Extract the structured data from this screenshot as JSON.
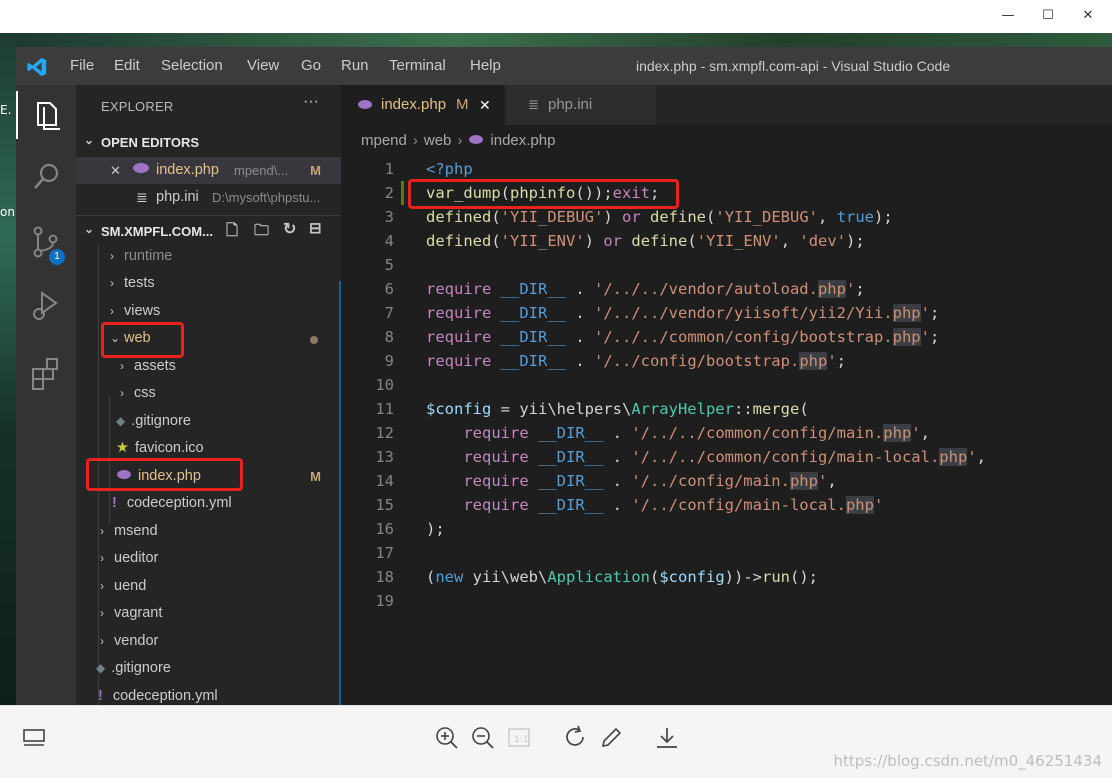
{
  "viewer": {
    "window_controls": {
      "minimize": "—",
      "maximize": "☐",
      "close": "✕"
    },
    "desktop_labels": [
      "E.",
      "on"
    ],
    "watermark": "https://blog.csdn.net/m0_46251434",
    "toolbar_icons": [
      "panel-toggle-icon",
      "zoom-in-icon",
      "zoom-out-icon",
      "actual-size-icon",
      "rotate-icon",
      "edit-icon",
      "download-icon"
    ]
  },
  "app": {
    "window_title": "index.php - sm.xmpfl.com-api - Visual Studio Code",
    "menu": [
      "File",
      "Edit",
      "Selection",
      "View",
      "Go",
      "Run",
      "Terminal",
      "Help"
    ],
    "source_control_badge": "1",
    "activity_icons": [
      "explorer-icon",
      "search-icon",
      "source-control-icon",
      "run-debug-icon",
      "extensions-icon"
    ]
  },
  "explorer": {
    "header": "EXPLORER",
    "more": "···",
    "open_editors": {
      "title": "OPEN EDITORS",
      "items": [
        {
          "close": "✕",
          "name": "index.php",
          "path": "mpend\\...",
          "status": "M"
        },
        {
          "name": "php.ini",
          "path": "D:\\mysoft\\phpstu..."
        }
      ]
    },
    "workspace": {
      "title": "SM.XMPFL.COM...",
      "tree": [
        {
          "chevron": "›",
          "name": "runtime"
        },
        {
          "chevron": "›",
          "name": "tests"
        },
        {
          "chevron": "›",
          "name": "views"
        },
        {
          "chevron": "⌄",
          "name": "web"
        },
        {
          "chevron": "›",
          "name": "assets"
        },
        {
          "chevron": "›",
          "name": "css"
        },
        {
          "name": ".gitignore"
        },
        {
          "name": "favicon.ico"
        },
        {
          "name": "index.php",
          "status": "M"
        },
        {
          "name": "codeception.yml"
        },
        {
          "chevron": "›",
          "name": "msend"
        },
        {
          "chevron": "›",
          "name": "ueditor"
        },
        {
          "chevron": "›",
          "name": "uend"
        },
        {
          "chevron": "›",
          "name": "vagrant"
        },
        {
          "chevron": "›",
          "name": "vendor"
        },
        {
          "name": ".gitignore"
        },
        {
          "name": "codeception.yml"
        }
      ]
    }
  },
  "tabs": [
    {
      "name": "index.php",
      "status": "M",
      "close": "✕"
    },
    {
      "name": "php.ini"
    }
  ],
  "breadcrumb": [
    "mpend",
    "web",
    "index.php"
  ],
  "breadcrumb_sep": "›",
  "code_lines": [
    "1",
    "2",
    "3",
    "4",
    "5",
    "6",
    "7",
    "8",
    "9",
    "10",
    "11",
    "12",
    "13",
    "14",
    "15",
    "16",
    "17",
    "18",
    "19"
  ]
}
